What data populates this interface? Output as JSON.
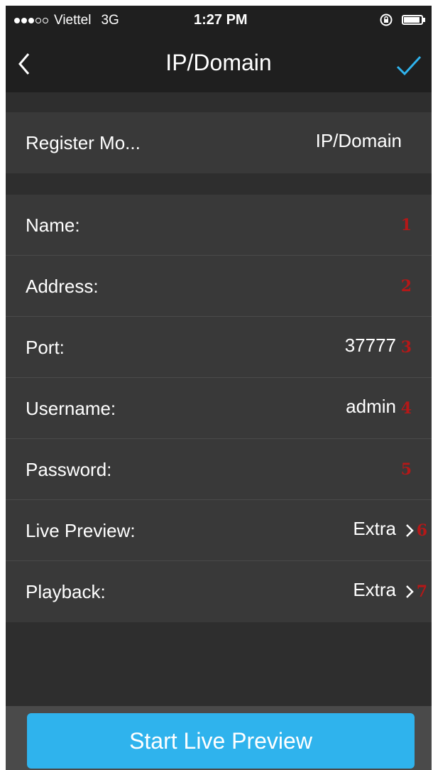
{
  "status_bar": {
    "carrier": "Viettel",
    "network": "3G",
    "time": "1:27 PM",
    "signal_bars": 3,
    "signal_total": 5
  },
  "nav": {
    "title": "IP/Domain",
    "back_icon": "chevron-left-icon",
    "confirm_icon": "checkmark-icon",
    "accent_color": "#2fb3ed"
  },
  "register": {
    "label": "Register Mo...",
    "value": "IP/Domain"
  },
  "fields": [
    {
      "label": "Name:",
      "value": "",
      "marker": "1"
    },
    {
      "label": "Address:",
      "value": "",
      "marker": "2"
    },
    {
      "label": "Port:",
      "value": "37777",
      "marker": "3"
    },
    {
      "label": "Username:",
      "value": "admin",
      "marker": "4"
    },
    {
      "label": "Password:",
      "value": "",
      "marker": "5"
    },
    {
      "label": "Live Preview:",
      "value": "Extra",
      "marker": "6"
    },
    {
      "label": "Playback:",
      "value": "Extra",
      "marker": "7"
    }
  ],
  "footer": {
    "start_button_label": "Start Live Preview"
  }
}
